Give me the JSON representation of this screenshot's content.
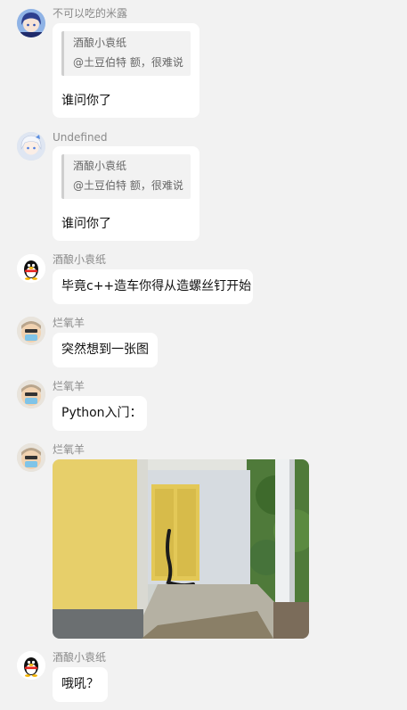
{
  "messages": [
    {
      "sender": "不可以吃的米露",
      "avatar_icon": "anime-girl-avatar",
      "quote": {
        "author": "酒酿小袁纸",
        "text": "@土豆伯特 额，很难说"
      },
      "text": "谁问你了"
    },
    {
      "sender": "Undefined",
      "avatar_icon": "anime-girl-white-hair-avatar",
      "quote": {
        "author": "酒酿小袁纸",
        "text": "@土豆伯特 额，很难说"
      },
      "text": "谁问你了"
    },
    {
      "sender": "酒酿小袁纸",
      "avatar_icon": "qq-penguin-avatar",
      "text": "毕竟c++造车你得从造螺丝钉开始"
    },
    {
      "sender": "烂氧羊",
      "avatar_icon": "cartoon-face-avatar",
      "text": "突然想到一张图"
    },
    {
      "sender": "烂氧羊",
      "avatar_icon": "cartoon-face-avatar",
      "text": "Python入门："
    },
    {
      "sender": "烂氧羊",
      "avatar_icon": "cartoon-face-avatar",
      "image": "snake-at-yellow-door-photo"
    },
    {
      "sender": "酒酿小袁纸",
      "avatar_icon": "qq-penguin-avatar",
      "text": "哦吼？"
    }
  ]
}
